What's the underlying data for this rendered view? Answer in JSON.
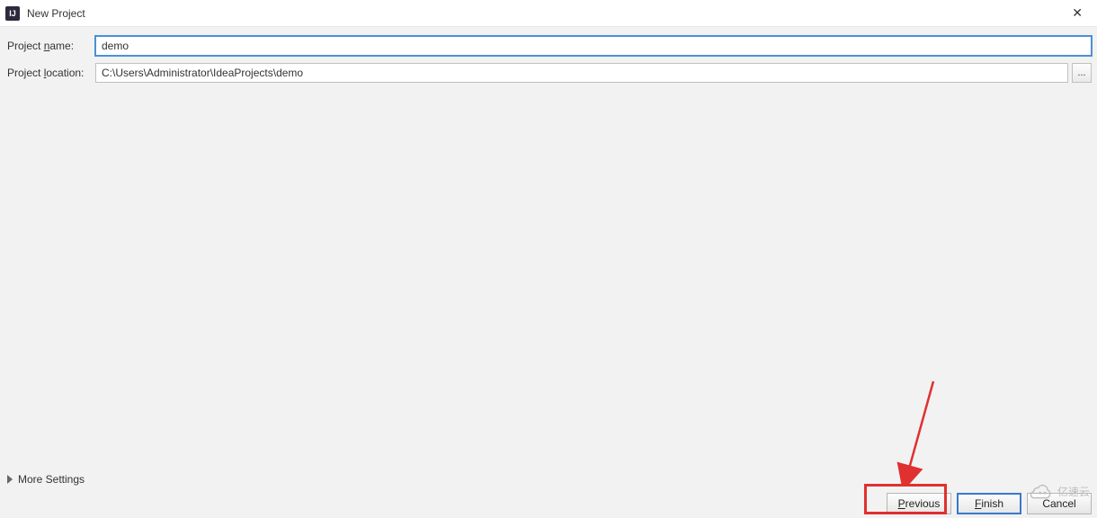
{
  "title": "New Project",
  "close_glyph": "✕",
  "app_icon_text": "IJ",
  "labels": {
    "project_name_prefix": "Project ",
    "project_name_accel": "n",
    "project_name_suffix": "ame:",
    "project_location_prefix": "Project ",
    "project_location_accel": "l",
    "project_location_suffix": "ocation:"
  },
  "fields": {
    "project_name": "demo",
    "project_location": "C:\\Users\\Administrator\\IdeaProjects\\demo",
    "browse_label": "..."
  },
  "more_settings_label": "More Settings",
  "buttons": {
    "previous_accel": "P",
    "previous_rest": "revious",
    "finish_accel": "F",
    "finish_rest": "inish",
    "cancel": "Cancel"
  },
  "watermark_text": "亿速云"
}
